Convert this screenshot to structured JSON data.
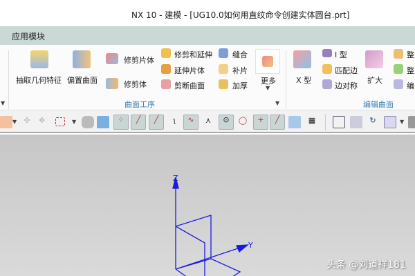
{
  "window": {
    "title": "NX 10 - 建模 - [UG10.0如何用直纹命令创建实体圆台.prt]"
  },
  "menubar": {
    "label": "应用模块"
  },
  "ribbon": {
    "surface_ops": {
      "group_label": "曲面工序",
      "extract_geometry": "抽取几何特征",
      "offset_surface": "偏置曲面",
      "trim_sheet": "修剪片体",
      "trim_body": "修剪体",
      "trim_extend": "修剪和延伸",
      "extend_sheet": "延伸片体",
      "divide_face": "剪断曲面",
      "sew": "缝合",
      "patch": "补片",
      "thicken": "加厚",
      "more": "更多"
    },
    "edit_surface": {
      "group_label": "编辑曲面",
      "x_form": "X 型",
      "i_form": "I 型",
      "match_edge": "匹配边",
      "edge_symmetry": "边对称",
      "enlarge": "扩大",
      "item1": "整",
      "item2": "整",
      "item3": "编"
    }
  },
  "viewport": {
    "axis_z": "Z",
    "axis_y": "Y",
    "watermark": "头条 @刘道祥181"
  }
}
